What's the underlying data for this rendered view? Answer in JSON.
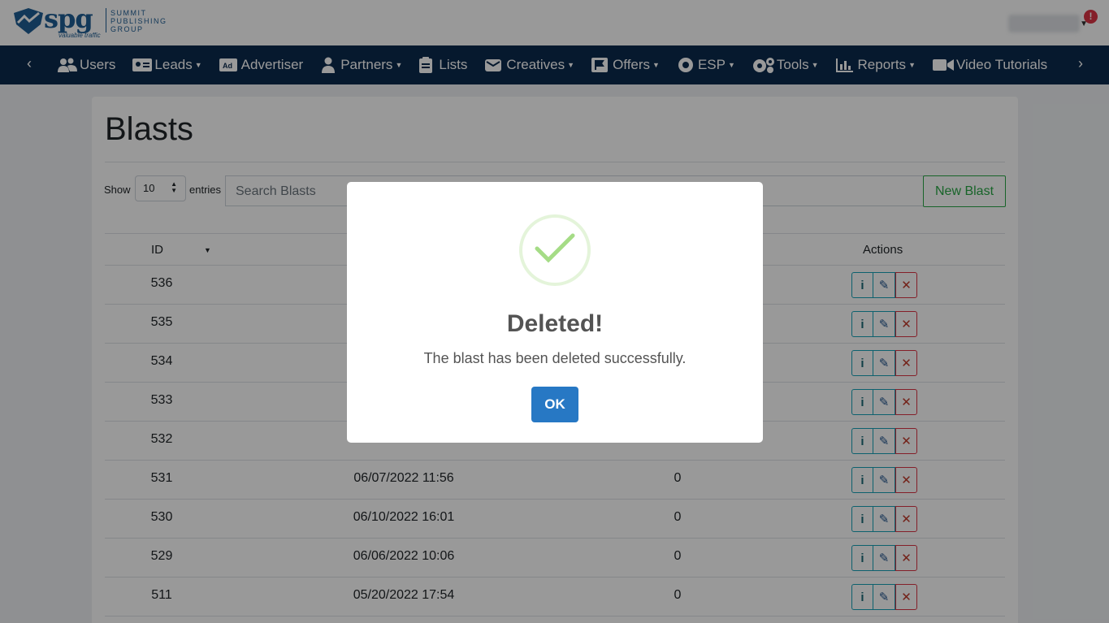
{
  "brand": {
    "logo_text": "spg",
    "name_lines": [
      "SUMMIT",
      "PUBLISHING",
      "GROUP"
    ],
    "tagline": "valuable traffic"
  },
  "header": {
    "alert_count": "!"
  },
  "nav": {
    "items": [
      {
        "label": "Users",
        "icon": "users-icon",
        "dropdown": false
      },
      {
        "label": "Leads",
        "icon": "id-card-icon",
        "dropdown": true
      },
      {
        "label": "Advertiser",
        "icon": "ad-icon",
        "dropdown": false
      },
      {
        "label": "Partners",
        "icon": "user-tie-icon",
        "dropdown": true
      },
      {
        "label": "Lists",
        "icon": "clipboard-list-icon",
        "dropdown": false
      },
      {
        "label": "Creatives",
        "icon": "mail-bulk-icon",
        "dropdown": true
      },
      {
        "label": "Offers",
        "icon": "flag-icon",
        "dropdown": true
      },
      {
        "label": "ESP",
        "icon": "esp-icon",
        "dropdown": true
      },
      {
        "label": "Tools",
        "icon": "cogs-icon",
        "dropdown": true
      },
      {
        "label": "Reports",
        "icon": "chart-icon",
        "dropdown": true
      },
      {
        "label": "Video Tutorials",
        "icon": "video-icon",
        "dropdown": false
      }
    ]
  },
  "page": {
    "title": "Blasts",
    "show_label": "Show",
    "entries_value": "10",
    "entries_label": "entries",
    "search_placeholder": "Search Blasts",
    "new_button": "New Blast"
  },
  "table": {
    "headers": {
      "id": "ID",
      "actions": "Actions"
    },
    "rows": [
      {
        "id": "536",
        "date": "",
        "count": ""
      },
      {
        "id": "535",
        "date": "",
        "count": ""
      },
      {
        "id": "534",
        "date": "",
        "count": ""
      },
      {
        "id": "533",
        "date": "",
        "count": ""
      },
      {
        "id": "532",
        "date": "",
        "count": ""
      },
      {
        "id": "531",
        "date": "06/07/2022 11:56",
        "count": "0"
      },
      {
        "id": "530",
        "date": "06/10/2022 16:01",
        "count": "0"
      },
      {
        "id": "529",
        "date": "06/06/2022 10:06",
        "count": "0"
      },
      {
        "id": "511",
        "date": "05/20/2022 17:54",
        "count": "0"
      }
    ],
    "action_labels": {
      "info": "i",
      "edit": "✎",
      "delete": "✕"
    }
  },
  "modal": {
    "title": "Deleted!",
    "message": "The blast has been deleted successfully.",
    "ok_label": "OK",
    "icon": "success-check-icon",
    "accent": "#a5dc86",
    "button_color": "#2778c4"
  }
}
